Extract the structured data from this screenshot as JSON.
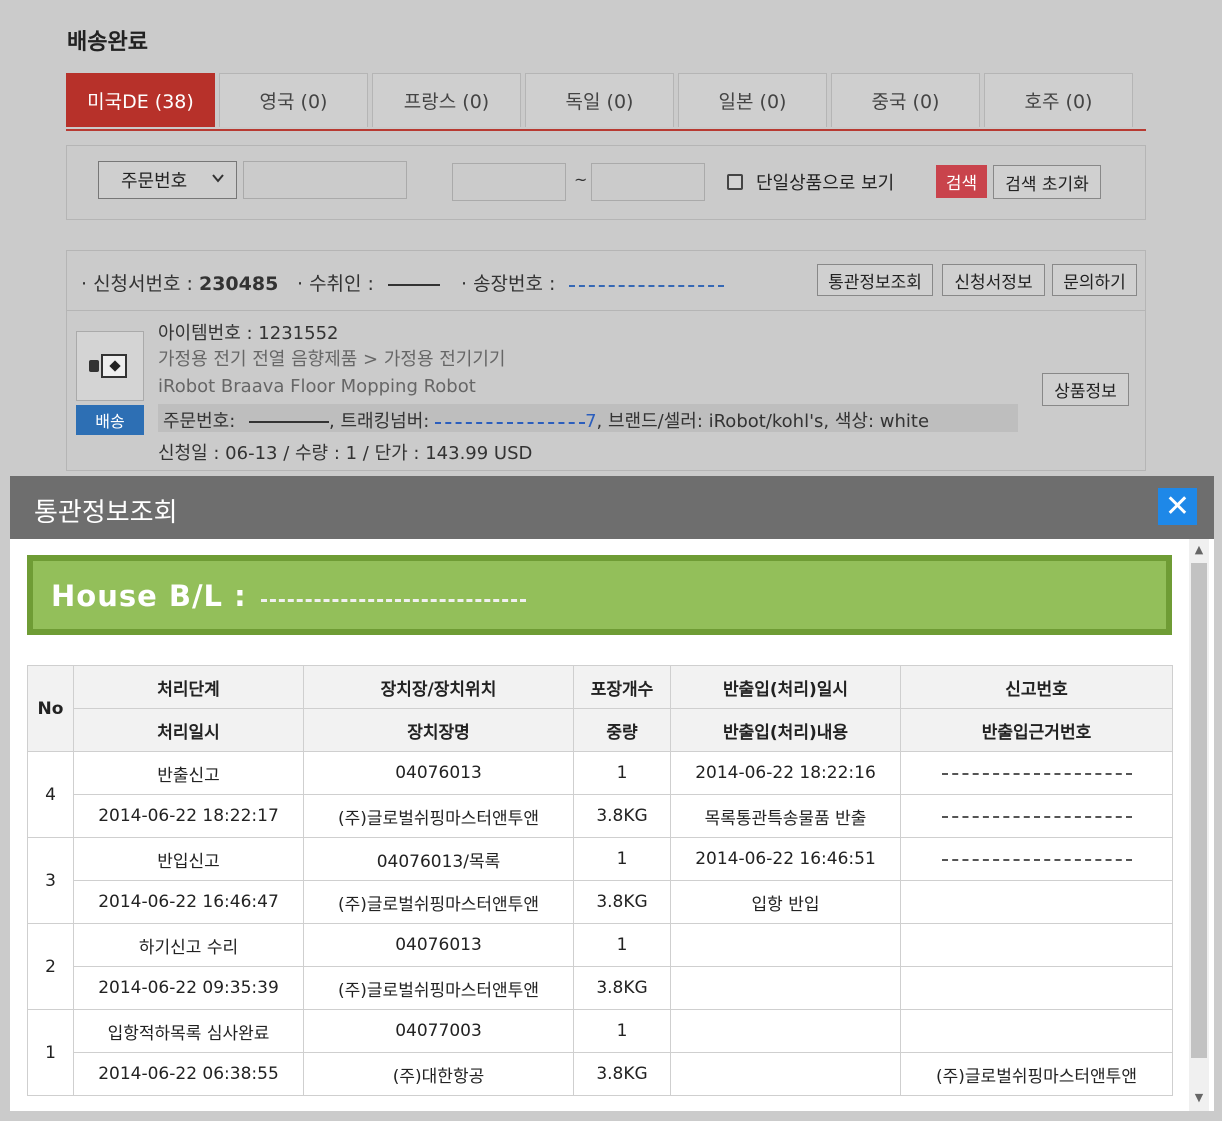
{
  "page": {
    "title": "배송완료"
  },
  "tabs": [
    {
      "label": "미국DE (38)",
      "active": true
    },
    {
      "label": "영국 (0)",
      "active": false
    },
    {
      "label": "프랑스 (0)",
      "active": false
    },
    {
      "label": "독일 (0)",
      "active": false
    },
    {
      "label": "일본 (0)",
      "active": false
    },
    {
      "label": "중국 (0)",
      "active": false
    },
    {
      "label": "호주 (0)",
      "active": false
    }
  ],
  "search": {
    "field_select": "주문번호",
    "single_item_label": "단일상품으로 보기",
    "search_label": "검색",
    "reset_label": "검색 초기화",
    "range_sep": "~"
  },
  "order": {
    "app_no_label": "· 신청서번호 : ",
    "app_no": "230485",
    "recipient_label": "· 수취인 : ",
    "invoice_label": "· 송장번호 : ",
    "buttons": {
      "customs": "통관정보조회",
      "application": "신청서정보",
      "inquiry": "문의하기"
    },
    "item": {
      "item_no": "아이템번호 : 1231552",
      "category": "가정용 전기 전열 음향제품 > 가정용 전기기기",
      "name": "iRobot Braava Floor Mopping Robot",
      "order_no_label": "주문번호: ",
      "tracking_label": ", 트래킹넘버: ",
      "tracking_tail": "7",
      "brand_color": ", 브랜드/셀러: iRobot/kohl's, 색상: white",
      "summary": "신청일 : 06-13 / 수량 : 1 / 단가 : 143.99 USD",
      "status_badge": "배송",
      "product_info_label": "상품정보"
    }
  },
  "modal": {
    "title": "통관정보조회",
    "close_glyph": "✕",
    "bl_label": "House B/L :",
    "table": {
      "header_row1": {
        "no": "No",
        "stage": "처리단계",
        "location": "장치장/장치위치",
        "packages": "포장개수",
        "datetime": "반출입(처리)일시",
        "report_no": "신고번호"
      },
      "header_row2": {
        "stage_time": "처리일시",
        "location_name": "장치장명",
        "weight": "중량",
        "detail": "반출입(처리)내용",
        "basis_no": "반출입근거번호"
      },
      "rows": [
        {
          "no": "4",
          "stage": "반출신고",
          "location": "04076013",
          "packages": "1",
          "datetime": "2014-06-22 18:22:16",
          "stage_time": "2014-06-22 18:22:17",
          "location_name": "(주)글로벌쉬핑마스터앤투앤",
          "weight": "3.8KG",
          "detail": "목록통관특송물품 반출",
          "basis_no": ""
        },
        {
          "no": "3",
          "stage": "반입신고",
          "location": "04076013/목록",
          "packages": "1",
          "datetime": "2014-06-22 16:46:51",
          "stage_time": "2014-06-22 16:46:47",
          "location_name": "(주)글로벌쉬핑마스터앤투앤",
          "weight": "3.8KG",
          "detail": "입항 반입",
          "basis_no": ""
        },
        {
          "no": "2",
          "stage": "하기신고 수리",
          "location": "04076013",
          "packages": "1",
          "datetime": "",
          "stage_time": "2014-06-22 09:35:39",
          "location_name": "(주)글로벌쉬핑마스터앤투앤",
          "weight": "3.8KG",
          "detail": "",
          "basis_no": ""
        },
        {
          "no": "1",
          "stage": "입항적하목록 심사완료",
          "location": "04077003",
          "packages": "1",
          "datetime": "",
          "stage_time": "2014-06-22 06:38:55",
          "location_name": "(주)대한항공",
          "weight": "3.8KG",
          "detail": "",
          "basis_no": "(주)글로벌쉬핑마스터앤투앤"
        }
      ]
    }
  },
  "colors": {
    "accent_red": "#b7312a",
    "search_red": "#c9434c",
    "badge_blue": "#2d6fb4",
    "bl_green": "#93bf5a",
    "close_blue": "#1e88e8"
  }
}
